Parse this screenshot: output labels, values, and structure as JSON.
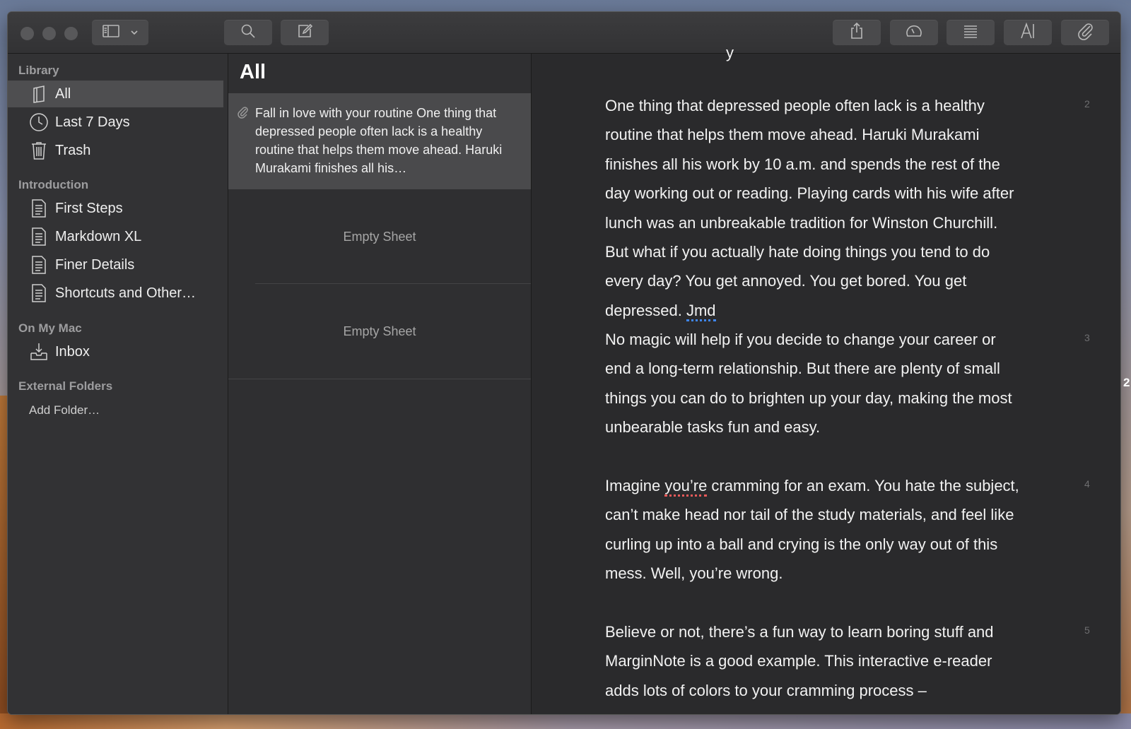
{
  "sidebar": {
    "sections": [
      {
        "title": "Library",
        "items": [
          {
            "label": "All",
            "icon": "library-icon",
            "selected": true
          },
          {
            "label": "Last 7 Days",
            "icon": "clock-icon"
          },
          {
            "label": "Trash",
            "icon": "trash-icon"
          }
        ]
      },
      {
        "title": "Introduction",
        "items": [
          {
            "label": "First Steps",
            "icon": "sheet-icon"
          },
          {
            "label": "Markdown XL",
            "icon": "sheet-icon"
          },
          {
            "label": "Finer Details",
            "icon": "sheet-icon"
          },
          {
            "label": "Shortcuts and Other…",
            "icon": "sheet-icon"
          }
        ]
      },
      {
        "title": "On My Mac",
        "items": [
          {
            "label": "Inbox",
            "icon": "inbox-icon"
          }
        ]
      },
      {
        "title": "External Folders",
        "items": []
      }
    ],
    "add_folder_label": "Add Folder…"
  },
  "sheet_list": {
    "title": "All",
    "sheets": [
      {
        "preview": "Fall in love with your routine One thing that depressed people often lack is a healthy routine that helps them move ahead. Haruki Murakami finishes all his…",
        "has_attachment": true
      },
      {
        "preview": "Empty Sheet"
      },
      {
        "preview": "Empty Sheet"
      }
    ]
  },
  "editor": {
    "paragraphs": [
      {
        "line_number": "2",
        "before": "One thing that depressed people often lack is a healthy routine that helps them move ahead. Haruki Murakami finishes all his work by 10 a.m. and spends the rest of the day working out or reading. Playing cards with his wife after lunch was an unbreakable tradition for Winston Churchill. But what if you actually hate doing things you tend to do every day? You get annoyed. You get bored. You get depressed. ",
        "flagged": "Jmd",
        "after": ""
      },
      {
        "line_number": "3",
        "text": "No magic will help if you decide to change your career or end a long-term relationship. But there are plenty of small things you can do to brighten up your day, making the most unbearable tasks fun and easy."
      },
      {
        "line_number": "4",
        "before": "Imagine ",
        "flagged": "you’re",
        "after": " cramming for an exam. You hate the subject, can’t make head nor tail of the study materials, and feel like curling up into a ball and crying is the only way out of this mess. Well, you’re wrong."
      },
      {
        "line_number": "5",
        "text": "Believe or not, there’s a fun way to learn boring stuff and MarginNote is a good example. This interactive e-reader adds lots of colors to your cramming process –"
      }
    ],
    "right_edge_marker": "2"
  },
  "colors": {
    "window_bg": "#2b2b2d",
    "sidebar_bg": "#323234",
    "selected_bg": "#4e4e50",
    "spell_blue": "#3f86f0",
    "spell_red": "#e85a5a"
  }
}
